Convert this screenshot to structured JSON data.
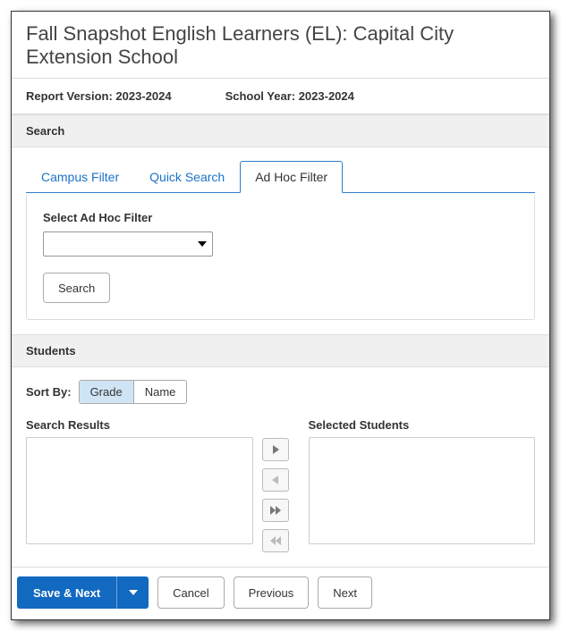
{
  "title": "Fall Snapshot English Learners (EL): Capital City Extension School",
  "meta": {
    "report_version_label": "Report Version: 2023-2024",
    "school_year_label": "School Year: 2023-2024"
  },
  "search": {
    "header": "Search",
    "tabs": {
      "campus": "Campus Filter",
      "quick": "Quick Search",
      "adhoc": "Ad Hoc Filter"
    },
    "adhoc_panel": {
      "select_label": "Select Ad Hoc Filter",
      "search_button": "Search"
    }
  },
  "students": {
    "header": "Students",
    "sort_by_label": "Sort By:",
    "sort_options": {
      "grade": "Grade",
      "name": "Name"
    },
    "search_results_label": "Search Results",
    "selected_students_label": "Selected Students"
  },
  "footer": {
    "save_next": "Save & Next",
    "cancel": "Cancel",
    "previous": "Previous",
    "next": "Next"
  }
}
